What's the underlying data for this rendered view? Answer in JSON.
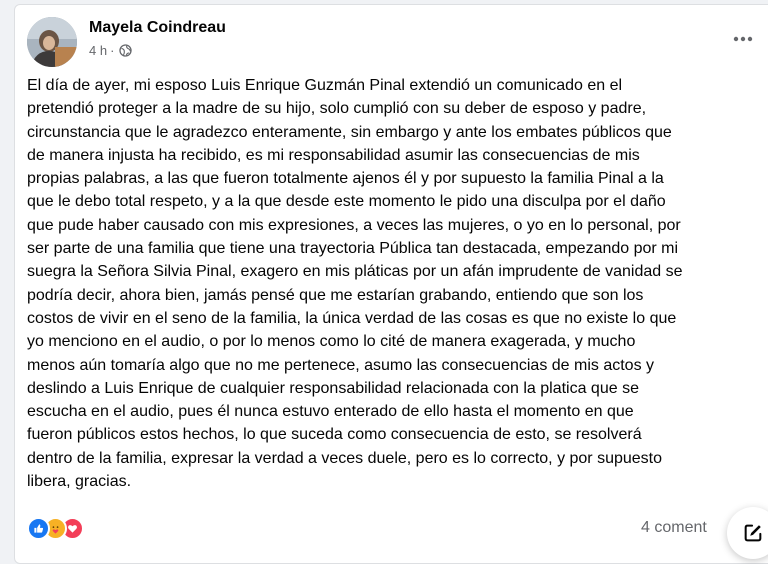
{
  "post": {
    "author": "Mayela Coindreau",
    "time": "4 h",
    "separator": "·",
    "privacy_icon": "globe-icon",
    "more_icon": "more-options-icon",
    "text_lines": [
      "El día de ayer, mi esposo Luis Enrique Guzmán Pinal extendió un comunicado en el",
      "pretendió proteger a la madre de su hijo, solo cumplió con su deber de esposo y padre,",
      "circunstancia que le agradezco enteramente, sin embargo y ante los embates públicos que",
      "de manera injusta ha recibido, es mi responsabilidad asumir las consecuencias de mis",
      "propias palabras, a las que fueron totalmente ajenos él y por supuesto la familia Pinal a la",
      "que le debo total respeto, y a la que desde este momento le pido una disculpa por el daño",
      "que pude haber causado con mis expresiones, a veces las mujeres, o yo en lo personal, por",
      "ser parte de una familia que tiene una trayectoria Pública tan destacada, empezando por mi",
      "suegra la Señora Silvia Pinal, exagero en mis pláticas por un afán imprudente de vanidad se",
      "podría decir, ahora bien, jamás pensé que me estarían grabando, entiendo que son los",
      "costos de vivir en el seno de la familia, la única verdad de las cosas es que no existe lo que",
      "yo menciono en el audio, o por lo menos como lo cité de manera exagerada, y mucho",
      "menos aún tomaría algo que no me pertenece, asumo las consecuencias de mis actos y",
      "deslindo a Luis Enrique de cualquier responsabilidad relacionada con la platica que se",
      "escucha en el audio, pues él nunca estuvo enterado de ello hasta el momento en que",
      "fueron públicos estos hechos, lo que suceda como consecuencia de esto, se resolverá",
      "dentro de la familia, expresar la verdad a veces duele, pero es lo correcto, y por supuesto",
      "libera, gracias."
    ]
  },
  "footer": {
    "reactions": [
      {
        "type": "like",
        "icon": "like-reaction-icon",
        "color": "#1877f2"
      },
      {
        "type": "care",
        "icon": "care-reaction-icon",
        "color": "#f7b125"
      },
      {
        "type": "love",
        "icon": "love-reaction-icon",
        "color": "#f33e58"
      }
    ],
    "comments_label": "4 coment",
    "compose_icon": "compose-icon"
  },
  "colors": {
    "background": "#f0f2f5",
    "card": "#ffffff",
    "text": "#050505",
    "secondary_text": "#65676b"
  }
}
